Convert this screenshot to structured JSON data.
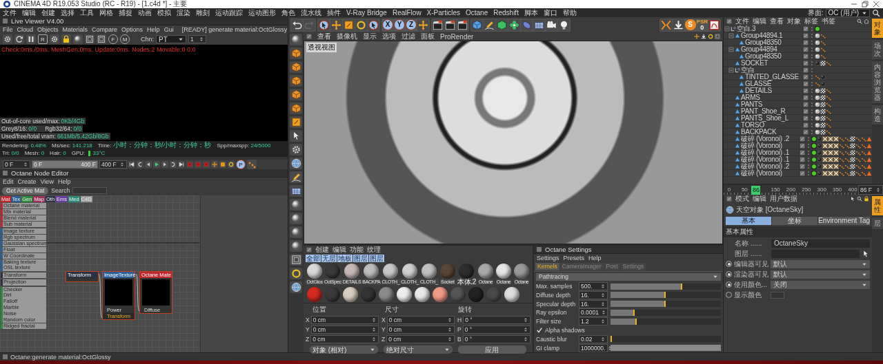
{
  "window": {
    "title": "CINEMA 4D R19.053 Studio (RC - R19) - [1.c4d *] - 主要"
  },
  "menu_bar": [
    "文件",
    "编辑",
    "创建",
    "选择",
    "工具",
    "网格",
    "捕捉",
    "动画",
    "模拟",
    "渲染",
    "雕刻",
    "运动跟踪",
    "运动图形",
    "角色",
    "流水线",
    "插件",
    "V-Ray Bridge",
    "RealFlow",
    "X-Particles",
    "Octane",
    "Redshift",
    "脚本",
    "窗口",
    "帮助"
  ],
  "layout_selector": {
    "label": "界面:",
    "value": "OC (用户)"
  },
  "live_viewer": {
    "title": "Live Viewer V4.00",
    "menu": [
      "File",
      "Cloud",
      "Objects",
      "Materials",
      "Compare",
      "Options",
      "Help",
      "Gui"
    ],
    "status": "[READY] generate material:OctGlossy",
    "letter_buttons": [
      "R",
      "F",
      "M"
    ],
    "channel_label": "Chn:",
    "channel_value": "PT",
    "channel_index": "1",
    "log": "Check:0ms./0ms. MeshGen:0ms. Update:0ms. Nodes:2 Movable:0 0:0",
    "memory": [
      {
        "label": "Out-of-core used/max:",
        "value": "0Kb/4Gb"
      },
      {
        "label": "Grey8/16:",
        "value": "0/0",
        "label_2": "Rgb32/64:",
        "value_2": "0/0"
      },
      {
        "label": "Used/free/total vram:",
        "value": "661Mb/5.42Gb/8Gb"
      }
    ],
    "stats": [
      {
        "label": "Rendering:",
        "value": "0.48%"
      },
      {
        "label": "Ms/sec:",
        "value": "141.218"
      },
      {
        "label": "Time:",
        "value": "小时：分钟：秒/小时：分钟：秒"
      },
      {
        "label": "Spp/maxspp:",
        "value": "24/5000"
      },
      {
        "label": "Tri:",
        "value": "0/0"
      },
      {
        "label": "Mesh:",
        "value": "0"
      },
      {
        "label": "Hair:",
        "value": "0"
      },
      {
        "label": "GPU:",
        "value": "33°C"
      }
    ]
  },
  "timeline": {
    "start": "0 F",
    "range_start": "0 F",
    "range_end": "400 F",
    "level": 1,
    "end": "400 F",
    "key_button": "P"
  },
  "node_editor": {
    "title": "Octane Node Editor",
    "menu": [
      "Edit",
      "Create",
      "View",
      "Help"
    ],
    "get_button": "Get Active Mat",
    "search_label": "Search",
    "tabs": [
      {
        "label": "Mat",
        "color": "#c0262b"
      },
      {
        "label": "Tex",
        "color": "#2a5f9a"
      },
      {
        "label": "Gen",
        "color": "#2a8a3a"
      },
      {
        "label": "Map",
        "color": "#a0305a"
      },
      {
        "label": "Oth",
        "color": "#2b3042"
      },
      {
        "label": "Ems",
        "color": "#6a3aa0"
      },
      {
        "label": "Med",
        "color": "#2a8a7a"
      },
      {
        "label": "C4D",
        "color": "#9a9a9a"
      }
    ],
    "groups": [
      [
        {
          "label": "Octane material",
          "color": "#c0262b"
        },
        {
          "label": "Mix material",
          "color": "#c0262b"
        },
        {
          "label": "Blend material",
          "color": "#c0262b"
        },
        {
          "label": "Sub material",
          "color": "#c0262b"
        }
      ],
      [
        {
          "label": "Image texture",
          "color": "#2a5f9a"
        },
        {
          "label": "Rgb spectrum",
          "color": "#2a5f9a"
        },
        {
          "label": "Gaussian spectrum",
          "color": "#2a5f9a"
        },
        {
          "label": "Float",
          "color": "#2a5f9a"
        },
        {
          "label": "W Coordinate",
          "color": "#2a5f9a"
        },
        {
          "label": "Baking texture",
          "color": "#2a5f9a"
        },
        {
          "label": "OSL texture",
          "color": "#2a5f9a"
        }
      ],
      [
        {
          "label": "Transform",
          "color": "#2b3042"
        }
      ],
      [
        {
          "label": "Projection",
          "color": "#2b3042"
        }
      ],
      [
        {
          "label": "Checker",
          "color": "#2a8a3a"
        },
        {
          "label": "Dirt",
          "color": "#2a8a3a"
        },
        {
          "label": "Falloff",
          "color": "#2a8a3a"
        },
        {
          "label": "Marble",
          "color": "#2a8a3a"
        },
        {
          "label": "Noise",
          "color": "#2a8a3a"
        },
        {
          "label": "Random color",
          "color": "#2a8a3a"
        },
        {
          "label": "Ridged fractal",
          "color": "#2a8a3a"
        }
      ]
    ],
    "nodes": [
      {
        "title": "Transform",
        "color": "#2b3042",
        "preview": false
      },
      {
        "title": "ImageTexture",
        "color": "#2a5f9a",
        "preview": true,
        "ports": [
          {
            "label": "Power",
            "highlighted": false
          },
          {
            "label": "Transform",
            "highlighted": true
          }
        ]
      },
      {
        "title": "Octane Mate",
        "color": "#c0262b",
        "preview": true,
        "ports": [
          {
            "label": "Diffuse",
            "highlighted": false
          }
        ]
      }
    ]
  },
  "toolbar": {
    "axis_buttons": [
      "X",
      "Y",
      "Z"
    ],
    "snap_label": "S",
    "psr_label": "PSR",
    "psr_value": "0"
  },
  "viewport": {
    "menu": [
      "查看",
      "摄像机",
      "显示",
      "选项",
      "过滤",
      "面板",
      "ProRender"
    ],
    "label": "透视视图"
  },
  "material_manager": {
    "menu": [
      "创建",
      "编辑",
      "功能",
      "纹理"
    ],
    "filters": [
      "全部",
      "无层",
      "地板",
      "图层",
      "图层"
    ],
    "rows": [
      [
        {
          "label": "OctGlos",
          "color": "#d8d8d8"
        },
        {
          "label": "OctSpec",
          "color": "#3a3a3a"
        },
        {
          "label": "DETAILS",
          "color": "#c9b8b8"
        },
        {
          "label": "BACKPA",
          "color": "#bdbdbd"
        },
        {
          "label": "CLOTH_",
          "color": "#c8c8c8"
        },
        {
          "label": "CLOTH_",
          "color": "#d0d0d0"
        },
        {
          "label": "CLOTH_",
          "color": "#c0c0c0"
        },
        {
          "label": "Socket",
          "color": "#5a4636"
        },
        {
          "label": "本体.2",
          "color": "#2e2e2e"
        },
        {
          "label": "Octane",
          "color": "#a8a8a8"
        },
        {
          "label": "Octane",
          "color": "#e6e6e6"
        },
        {
          "label": "Octane",
          "color": "#9a9a9a"
        }
      ],
      [
        {
          "color": "#d42a1f"
        },
        {
          "color": "#3a3a3a"
        },
        {
          "color": "#d9cfc0"
        },
        {
          "color": "#333333"
        },
        {
          "color": "#8a8a8a"
        },
        {
          "color": "#eeeeee"
        },
        {
          "color": "#e8e8e8"
        },
        {
          "color": "#f19a86"
        },
        {
          "color": "#555555"
        },
        {
          "color": "#222222"
        },
        {
          "color": "#4a4a4a"
        },
        {
          "color": "#dcdcdc"
        }
      ]
    ]
  },
  "coordinates": {
    "headers": [
      "位置",
      "尺寸",
      "旋转"
    ],
    "rows": [
      [
        {
          "axis": "X",
          "value": "0 cm"
        },
        {
          "axis": "X",
          "value": "0 cm"
        },
        {
          "axis": "H",
          "value": "0 °"
        }
      ],
      [
        {
          "axis": "Y",
          "value": "0 cm"
        },
        {
          "axis": "Y",
          "value": "0 cm"
        },
        {
          "axis": "P",
          "value": "0 °"
        }
      ],
      [
        {
          "axis": "Z",
          "value": "0 cm"
        },
        {
          "axis": "Z",
          "value": "0 cm"
        },
        {
          "axis": "B",
          "value": "0 °"
        }
      ]
    ],
    "mode": "对象 (相对)",
    "size_mode": "绝对尺寸",
    "apply": "应用"
  },
  "octane_settings": {
    "title": "Octane Settings",
    "menu": [
      "Settings",
      "Presets",
      "Help"
    ],
    "tabs": [
      {
        "label": "Kernels",
        "selected": true
      },
      {
        "label": "CameraImager",
        "selected": false
      },
      {
        "label": "Post",
        "selected": false
      },
      {
        "label": "Settings",
        "selected": false
      }
    ],
    "kernel": "Pathtracing",
    "rows": [
      {
        "kind": "slider",
        "label": "Max. samples",
        "value": "500.",
        "level": 0.65
      },
      {
        "kind": "slider",
        "label": "Diffuse depth",
        "value": "16.",
        "level": 0.5
      },
      {
        "kind": "slider",
        "label": "Specular depth",
        "value": "16.",
        "level": 0.5
      },
      {
        "kind": "slider",
        "label": "Ray epsilon",
        "value": "0.0001",
        "level": 0.22
      },
      {
        "kind": "slider",
        "label": "Filter size",
        "value": "1.2",
        "level": 0.24
      },
      {
        "kind": "checkbox",
        "label": "Alpha shadows",
        "checked": true
      },
      {
        "kind": "slider",
        "label": "Caustic blur",
        "value": "0.02",
        "level": 0.01
      },
      {
        "kind": "slider",
        "label": "GI clamp",
        "value": "1000000.",
        "level": 1
      }
    ]
  },
  "object_manager": {
    "menu": [
      "文件",
      "编辑",
      "查看",
      "对象",
      "标签",
      "书签"
    ],
    "side_tabs": [
      {
        "label": "对象",
        "selected": true
      },
      {
        "label": "场次",
        "selected": false
      },
      {
        "label": "内容浏览器",
        "selected": false
      },
      {
        "label": "构造",
        "selected": false
      }
    ],
    "tree": [
      {
        "name": "空白.3",
        "kind": "null",
        "expanded": true,
        "tags": [
          {
            "kind": "greenball"
          }
        ],
        "children": [
          {
            "name": "Group44894.1",
            "kind": "poly",
            "expanded": true,
            "tags": [
              {
                "kind": "ball"
              },
              {
                "kind": "dots"
              }
            ],
            "children": [
              {
                "name": "Group48350",
                "kind": "poly",
                "tags": [
                  {
                    "kind": "ball"
                  },
                  {
                    "kind": "dots"
                  }
                ]
              }
            ]
          },
          {
            "name": "Group44894",
            "kind": "poly",
            "expanded": true,
            "tags": [
              {
                "kind": "ball"
              },
              {
                "kind": "dots"
              }
            ],
            "children": [
              {
                "name": "Group48350",
                "kind": "poly",
                "tags": [
                  {
                    "kind": "ball"
                  },
                  {
                    "kind": "dots"
                  }
                ]
              }
            ]
          },
          {
            "name": "SOCKET",
            "kind": "poly",
            "tags": [
              {
                "kind": "darkball"
              },
              {
                "kind": "checker"
              },
              {
                "kind": "dots"
              }
            ]
          },
          {
            "name": "空白",
            "kind": "null",
            "expanded": true,
            "children": [
              {
                "name": "TINTED_GLASSE",
                "kind": "poly",
                "tags": [
                  {
                    "kind": "dots"
                  },
                  {
                    "kind": "darkball"
                  }
                ]
              },
              {
                "name": "GLASSE",
                "kind": "poly",
                "tags": [
                  {
                    "kind": "dots"
                  },
                  {
                    "kind": "darkball"
                  }
                ]
              },
              {
                "name": "DETAILS",
                "kind": "poly",
                "tags": [
                  {
                    "kind": "ball"
                  },
                  {
                    "kind": "checker"
                  },
                  {
                    "kind": "dots"
                  }
                ]
              }
            ]
          },
          {
            "name": "ARMS",
            "kind": "poly",
            "tags": [
              {
                "kind": "ball"
              },
              {
                "kind": "checker"
              },
              {
                "kind": "dots"
              }
            ]
          },
          {
            "name": "PANTS",
            "kind": "poly",
            "tags": [
              {
                "kind": "ball"
              },
              {
                "kind": "checker"
              },
              {
                "kind": "dots"
              }
            ]
          },
          {
            "name": "PANT_Shoe_R",
            "kind": "poly",
            "tags": [
              {
                "kind": "ball"
              },
              {
                "kind": "checker"
              },
              {
                "kind": "dots"
              }
            ]
          },
          {
            "name": "PANTS_Shoe_L",
            "kind": "poly",
            "tags": [
              {
                "kind": "ball"
              },
              {
                "kind": "checker"
              },
              {
                "kind": "dots"
              }
            ]
          },
          {
            "name": "TORSO",
            "kind": "poly",
            "tags": [
              {
                "kind": "ball"
              },
              {
                "kind": "checker"
              },
              {
                "kind": "dots"
              }
            ]
          },
          {
            "name": "BACKPACK",
            "kind": "poly",
            "tags": [
              {
                "kind": "ball"
              },
              {
                "kind": "checker"
              },
              {
                "kind": "dots"
              }
            ]
          },
          {
            "name": "破碎 (Voronoi) .2",
            "kind": "poly",
            "tags": [
              {
                "kind": "greenball"
              },
              {
                "kind": "darkball"
              },
              {
                "kind": "cross"
              },
              {
                "kind": "cross"
              },
              {
                "kind": "cross"
              },
              {
                "kind": "dots"
              },
              {
                "kind": "dots"
              },
              {
                "kind": "checker"
              },
              {
                "kind": "dots"
              },
              {
                "kind": "dots"
              },
              {
                "kind": "triangle"
              }
            ]
          },
          {
            "name": "破碎 (Voronoi)",
            "kind": "poly",
            "tags": [
              {
                "kind": "greenball"
              },
              {
                "kind": "darkball"
              },
              {
                "kind": "cross"
              },
              {
                "kind": "cross"
              },
              {
                "kind": "cross"
              },
              {
                "kind": "dots"
              },
              {
                "kind": "dots"
              },
              {
                "kind": "checker"
              },
              {
                "kind": "dots"
              },
              {
                "kind": "dots"
              },
              {
                "kind": "triangle"
              }
            ]
          },
          {
            "name": "破碎 (Voronoi) .1",
            "kind": "poly",
            "tags": [
              {
                "kind": "greenball"
              },
              {
                "kind": "darkball"
              },
              {
                "kind": "cross"
              },
              {
                "kind": "cross"
              },
              {
                "kind": "cross"
              },
              {
                "kind": "dots"
              },
              {
                "kind": "dots"
              },
              {
                "kind": "checker"
              },
              {
                "kind": "dots"
              },
              {
                "kind": "dots"
              },
              {
                "kind": "triangle"
              }
            ]
          },
          {
            "name": "破碎 (Voronoi) .1",
            "kind": "poly",
            "tags": [
              {
                "kind": "greenball"
              },
              {
                "kind": "darkball"
              },
              {
                "kind": "cross"
              },
              {
                "kind": "cross"
              },
              {
                "kind": "cross"
              },
              {
                "kind": "dots"
              },
              {
                "kind": "dots"
              },
              {
                "kind": "checker"
              },
              {
                "kind": "dots"
              },
              {
                "kind": "dots"
              },
              {
                "kind": "triangle"
              }
            ]
          },
          {
            "name": "破碎 (Voronoi) .2",
            "kind": "poly",
            "tags": [
              {
                "kind": "greenball"
              },
              {
                "kind": "darkball"
              },
              {
                "kind": "cross"
              },
              {
                "kind": "cross"
              },
              {
                "kind": "cross"
              },
              {
                "kind": "dots"
              },
              {
                "kind": "dots"
              },
              {
                "kind": "checker"
              },
              {
                "kind": "dots"
              },
              {
                "kind": "dots"
              },
              {
                "kind": "triangle"
              }
            ]
          },
          {
            "name": "破碎 (Voronoi)",
            "kind": "poly",
            "tags": [
              {
                "kind": "greenball"
              },
              {
                "kind": "darkball"
              },
              {
                "kind": "cross"
              },
              {
                "kind": "cross"
              },
              {
                "kind": "cross"
              },
              {
                "kind": "dots"
              },
              {
                "kind": "dots"
              },
              {
                "kind": "checker"
              },
              {
                "kind": "dots"
              },
              {
                "kind": "dots"
              },
              {
                "kind": "triangle"
              }
            ]
          }
        ]
      }
    ]
  },
  "frame_ruler": {
    "ticks": [
      "0",
      "50",
      "150",
      "200",
      "250",
      "300",
      "350",
      "400"
    ],
    "current": "86",
    "level": 0.215,
    "field": "86 F"
  },
  "attributes": {
    "menu": [
      "模式",
      "编辑",
      "用户数据"
    ],
    "side_tabs": [
      {
        "label": "属性",
        "selected": true
      },
      {
        "label": "层",
        "selected": false
      }
    ],
    "object": "天空对象 [OctaneSky]",
    "tabs": [
      {
        "label": "基本",
        "selected": true
      },
      {
        "label": "坐标",
        "selected": false
      },
      {
        "label": "Environment Tag",
        "selected": false
      }
    ],
    "section": "基本属性",
    "rows": [
      {
        "kind": "text",
        "label": "名称 ......",
        "value": "OctaneSky"
      },
      {
        "kind": "link",
        "label": "图层 ......"
      },
      {
        "kind": "select",
        "label": "编辑器可见",
        "value": "默认",
        "checked": true
      },
      {
        "kind": "select",
        "label": "渲染器可见",
        "value": "默认",
        "checked": true
      },
      {
        "kind": "select",
        "label": "使用颜色...",
        "value": "关闭",
        "checked": true
      },
      {
        "kind": "color",
        "label": "显示颜色",
        "checked": false
      }
    ]
  },
  "status_bar": "Octane:generate material:OctGlossy"
}
